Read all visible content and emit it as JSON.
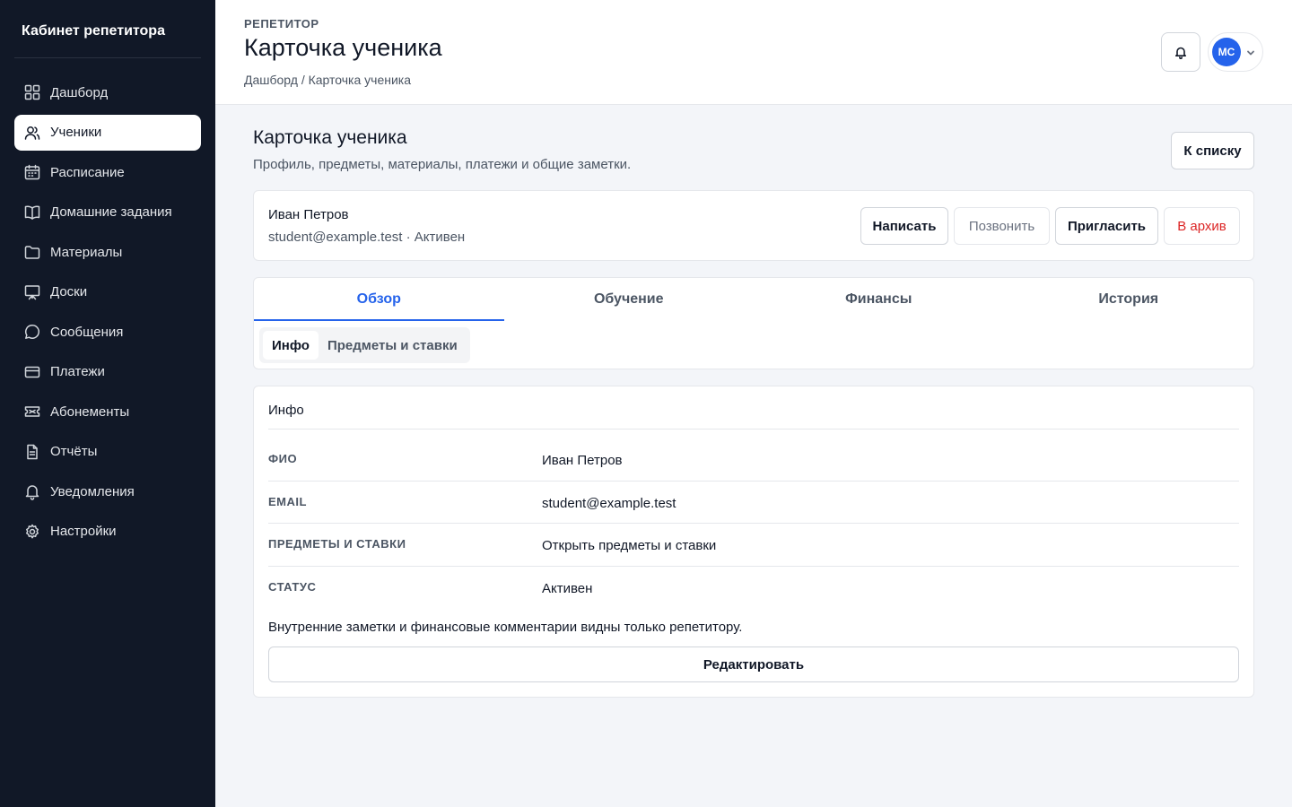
{
  "sidebar": {
    "brand": "Кабинет репетитора",
    "items": [
      {
        "label": "Дашборд",
        "icon": "grid-icon"
      },
      {
        "label": "Ученики",
        "icon": "users-icon",
        "active": true
      },
      {
        "label": "Расписание",
        "icon": "calendar-icon"
      },
      {
        "label": "Домашние задания",
        "icon": "book-icon"
      },
      {
        "label": "Материалы",
        "icon": "folder-icon"
      },
      {
        "label": "Доски",
        "icon": "board-icon"
      },
      {
        "label": "Сообщения",
        "icon": "chat-icon"
      },
      {
        "label": "Платежи",
        "icon": "card-icon"
      },
      {
        "label": "Абонементы",
        "icon": "ticket-icon"
      },
      {
        "label": "Отчёты",
        "icon": "report-icon"
      },
      {
        "label": "Уведомления",
        "icon": "bell-icon"
      },
      {
        "label": "Настройки",
        "icon": "gear-icon"
      }
    ]
  },
  "header": {
    "eyebrow": "РЕПЕТИТОР",
    "title": "Карточка ученика",
    "breadcrumb": "Дашборд / Карточка ученика",
    "avatar_initials": "МС"
  },
  "main": {
    "title": "Карточка ученика",
    "subtitle": "Профиль, предметы, материалы, платежи и общие заметки.",
    "back_button": "К списку"
  },
  "student": {
    "name": "Иван Петров",
    "meta": "student@example.test · Активен",
    "actions": {
      "write": "Написать",
      "call": "Позвонить",
      "invite": "Пригласить",
      "archive": "В архив"
    }
  },
  "tabs": [
    {
      "label": "Обзор",
      "active": true
    },
    {
      "label": "Обучение"
    },
    {
      "label": "Финансы"
    },
    {
      "label": "История"
    }
  ],
  "subtabs": [
    {
      "label": "Инфо",
      "active": true
    },
    {
      "label": "Предметы и ставки"
    }
  ],
  "info": {
    "title": "Инфо",
    "fields": [
      {
        "label": "ФИО",
        "value": "Иван Петров"
      },
      {
        "label": "EMAIL",
        "value": "student@example.test"
      },
      {
        "label": "ПРЕДМЕТЫ И СТАВКИ",
        "value": "Открыть предметы и ставки"
      },
      {
        "label": "СТАТУС",
        "value": "Активен"
      }
    ],
    "note": "Внутренние заметки и финансовые комментарии видны только репетитору.",
    "edit_button": "Редактировать"
  },
  "colors": {
    "sidebar_bg": "#111827",
    "accent": "#2563eb",
    "danger": "#dc2626",
    "page_bg": "#f3f5f9"
  }
}
